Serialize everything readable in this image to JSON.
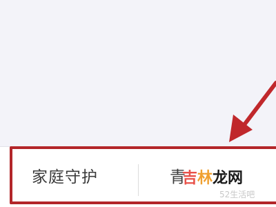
{
  "tabs": {
    "family_guard": "家庭守护",
    "teen_partial": "青"
  },
  "watermark": {
    "logo_part1": "吉",
    "logo_part2": "林",
    "logo_part3": "龙网",
    "subtext": "52生活吧"
  },
  "colors": {
    "annotation_red": "#b3262a",
    "background": "#f3f3f9"
  }
}
